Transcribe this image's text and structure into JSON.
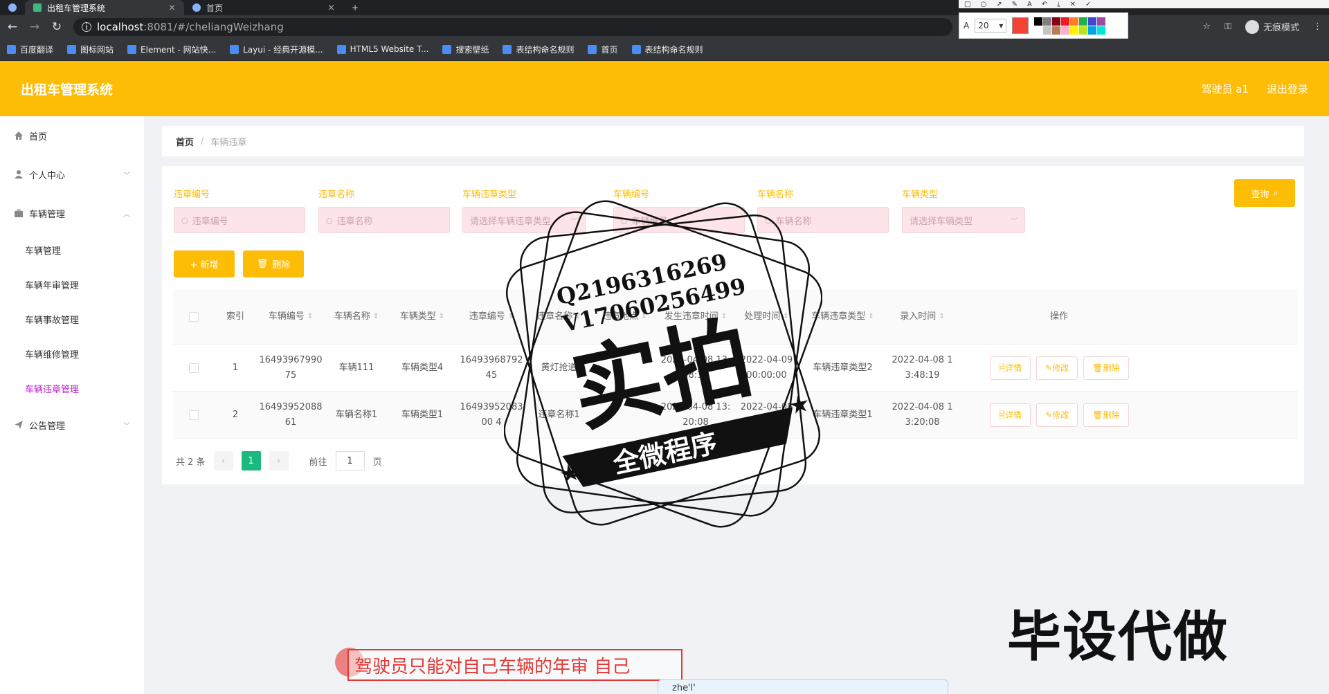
{
  "browser": {
    "tabs": [
      {
        "title": "出租车管理系统",
        "active": true
      },
      {
        "title": "首页",
        "active": false
      }
    ],
    "tab_close": "×",
    "new_tab": "+",
    "url_host": "localhost",
    "url_path": ":8081/#/cheliangWeizhang",
    "incognito_label": "无痕模式",
    "bookmarks": [
      "百度翻译",
      "图标网站",
      "Element - 网站快...",
      "Layui - 经典开源模...",
      "HTML5 Website T...",
      "搜索壁纸",
      "表结构命名规则",
      "首页",
      "表结构命名规则"
    ]
  },
  "annotation_tool": {
    "font_size": "20",
    "current_color": "#f44336",
    "palette": [
      "#000000",
      "#7f7f7f",
      "#880015",
      "#ed1c24",
      "#ff7f27",
      "#22b14c",
      "#3f48cc",
      "#a349a4",
      "#ffffff",
      "#c3c3c3",
      "#b97a57",
      "#ffaec9",
      "#fff200",
      "#b5e61d",
      "#00a2e8",
      "#00e5d4"
    ]
  },
  "app": {
    "title": "出租车管理系统",
    "user": "驾驶员 a1",
    "logout": "退出登录",
    "accent": "#fdbc06"
  },
  "sidebar": {
    "items": [
      {
        "label": "首页",
        "icon": "home-icon",
        "chevron": ""
      },
      {
        "label": "个人中心",
        "icon": "user-icon",
        "chevron": "﹀"
      },
      {
        "label": "车辆管理",
        "icon": "briefcase-icon",
        "chevron": "︿"
      }
    ],
    "sub_items": [
      "车辆管理",
      "车辆年审管理",
      "车辆事故管理",
      "车辆维修管理",
      "车辆违章管理"
    ],
    "active_sub": 4,
    "last_item": {
      "label": "公告管理",
      "icon": "send-icon",
      "chevron": "﹀"
    }
  },
  "breadcrumb": {
    "home": "首页",
    "separator": "/",
    "current": "车辆违章"
  },
  "filters": [
    {
      "label": "违章编号",
      "placeholder": "违章编号",
      "type": "input"
    },
    {
      "label": "违章名称",
      "placeholder": "违章名称",
      "type": "input"
    },
    {
      "label": "车辆违章类型",
      "placeholder": "请选择车辆违章类型",
      "type": "select"
    },
    {
      "label": "车辆编号",
      "placeholder": "车辆编号",
      "type": "input"
    },
    {
      "label": "车辆名称",
      "placeholder": "车辆名称",
      "type": "input"
    },
    {
      "label": "车辆类型",
      "placeholder": "请选择车辆类型",
      "type": "select"
    }
  ],
  "buttons": {
    "search": "查询",
    "add": "+ 新增",
    "delete": "删除"
  },
  "table": {
    "columns": [
      "",
      "索引",
      "车辆编号",
      "车辆名称",
      "车辆类型",
      "违章编号",
      "违章名称",
      "违章地点",
      "发生违章时间",
      "处理时间",
      "车辆违章类型",
      "录入时间",
      "操作"
    ],
    "rows": [
      [
        "",
        "1",
        "1649396799075",
        "车辆111",
        "车辆类型4",
        "1649396879245",
        "黄灯抢道",
        "",
        "2022-04-08 13:48:10",
        "2022-04-09 00:00:00",
        "车辆违章类型2",
        "2022-04-08 13:48:19",
        ""
      ],
      [
        "",
        "2",
        "1649395208861",
        "车辆名称1",
        "车辆类型1",
        "1649395208300 4",
        "违章名称1",
        "",
        "2022-04-08 13:20:08",
        "2022-04-08 13:20:08",
        "车辆违章类型1",
        "2022-04-08 13:20:08",
        ""
      ]
    ],
    "row_actions": [
      "详情",
      "修改",
      "删除"
    ]
  },
  "pagination": {
    "total": "共 2 条",
    "prev": "‹",
    "current": "1",
    "next": "›",
    "goto_prefix": "前往",
    "goto_value": "1",
    "goto_suffix": "页"
  },
  "overlays": {
    "watermark_line1": "Q2196316269",
    "watermark_line2": "V17060256499",
    "watermark_main": "实拍",
    "watermark_ribbon": "全微程序",
    "promo": "毕设代做",
    "caption": "驾驶员只能对自己车辆的年审  自己",
    "ime_text": "zhe'l'"
  }
}
